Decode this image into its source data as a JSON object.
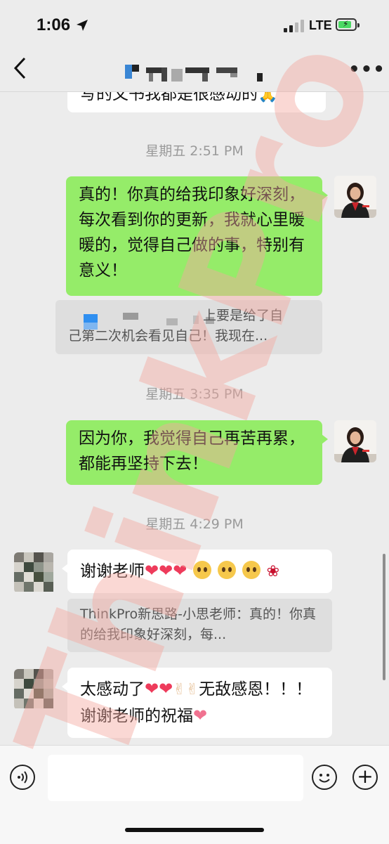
{
  "status_bar": {
    "time": "1:06",
    "network": "LTE"
  },
  "nav": {
    "back_symbol": "‹",
    "more_symbol": "•••"
  },
  "messages": {
    "partial_top": "写的文书我都是很感动的",
    "ts1": "星期五 2:51 PM",
    "sent1": "真的！你真的给我印象好深刻，每次看到你的更新，我就心里暖暖的，觉得自己做的事，特别有意义！",
    "quote1_line1": "上要是给了自",
    "quote1_line2": "己第二次机会看见自己！我现在...",
    "ts2": "星期五 3:35 PM",
    "sent2": "因为你，我觉得自己再苦再累，都能再坚持下去！",
    "ts3": "星期五 4:29 PM",
    "recv1": "谢谢老师",
    "quote2": "ThinkPro新思路-小思老师：真的！你真的给我印象好深刻，每...",
    "recv2_part1": "太感动了",
    "recv2_part2": "无敌感恩！！！谢谢老师的祝福"
  },
  "watermark": {
    "text": "ThinkPro"
  },
  "colors": {
    "sent_bubble": "#95ec69",
    "received_bubble": "#ffffff",
    "background": "#ececec",
    "watermark": "#f5a9a0"
  }
}
